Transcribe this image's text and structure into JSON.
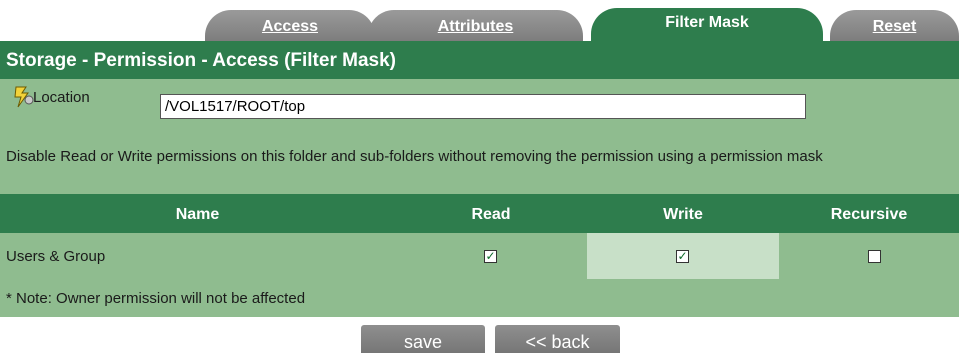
{
  "tabs": [
    {
      "label": "Access"
    },
    {
      "label": "Attributes"
    },
    {
      "label": "Filter Mask"
    },
    {
      "label": "Reset"
    }
  ],
  "header": {
    "title": "Storage - Permission - Access (Filter Mask)"
  },
  "location": {
    "label": "Location",
    "value": "/VOL1517/ROOT/top",
    "icon": "location-key-icon"
  },
  "description": "Disable Read or Write permissions on this folder and sub-folders without removing the permission using a permission mask",
  "table": {
    "columns": [
      "Name",
      "Read",
      "Write",
      "Recursive"
    ],
    "rows": [
      {
        "name": "Users & Group",
        "read": true,
        "write": true,
        "recursive": false
      }
    ]
  },
  "note": "* Note: Owner permission will not be affected",
  "buttons": {
    "save": "save",
    "back": "<< back"
  },
  "colors": {
    "header_green": "#2e7d4d",
    "panel_green": "#8fbc8f",
    "highlight_green": "#c8e0c8",
    "tab_gray": "#888888"
  }
}
